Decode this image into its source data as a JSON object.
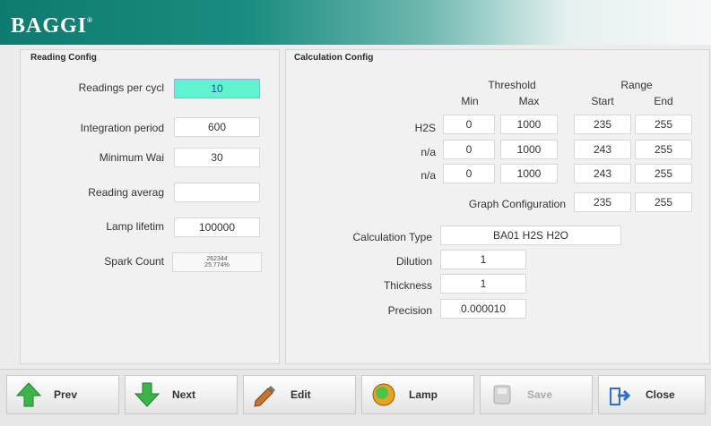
{
  "header": {
    "logo": "BAGGI",
    "logo_mark": "®"
  },
  "reading_config": {
    "title": "Reading Config",
    "fields": [
      {
        "label": "Readings per cycl",
        "value": "10"
      },
      {
        "label": "Integration period",
        "value": "600"
      },
      {
        "label": "Minimum Wai",
        "value": "30"
      },
      {
        "label": "Reading averag",
        "value": ""
      },
      {
        "label": "Lamp lifetim",
        "value": "100000"
      }
    ],
    "spark": {
      "label": "Spark Count",
      "line1": "262344",
      "line2": "25.774%"
    }
  },
  "calc_config": {
    "title": "Calculation Config",
    "threshold_label": "Threshold",
    "range_label": "Range",
    "min_label": "Min",
    "max_label": "Max",
    "start_label": "Start",
    "end_label": "End",
    "rows": [
      {
        "name": "H2S",
        "min": "0",
        "max": "1000",
        "start": "235",
        "end": "255"
      },
      {
        "name": "n/a",
        "min": "0",
        "max": "1000",
        "start": "243",
        "end": "255"
      },
      {
        "name": "n/a",
        "min": "0",
        "max": "1000",
        "start": "243",
        "end": "255"
      }
    ],
    "graph": {
      "label": "Graph Configuration",
      "start": "235",
      "end": "255"
    },
    "calc_type": {
      "label": "Calculation Type",
      "value": "BA01 H2S H2O"
    },
    "dilution": {
      "label": "Dilution",
      "value": "1"
    },
    "thickness": {
      "label": "Thickness",
      "value": "1"
    },
    "precision": {
      "label": "Precision",
      "value": "0.000010"
    }
  },
  "toolbar": {
    "prev": "Prev",
    "next": "Next",
    "edit": "Edit",
    "lamp": "Lamp",
    "save": "Save",
    "close": "Close"
  },
  "colors": {
    "header_teal": "#0f7b70",
    "active_field": "#5ff3cf",
    "arrow_green": "#3bb54a"
  },
  "icons": {
    "prev": "arrow-up-icon",
    "next": "arrow-down-icon",
    "edit": "pencil-icon",
    "lamp": "lamp-icon",
    "save": "save-icon",
    "close": "close-exit-icon"
  }
}
